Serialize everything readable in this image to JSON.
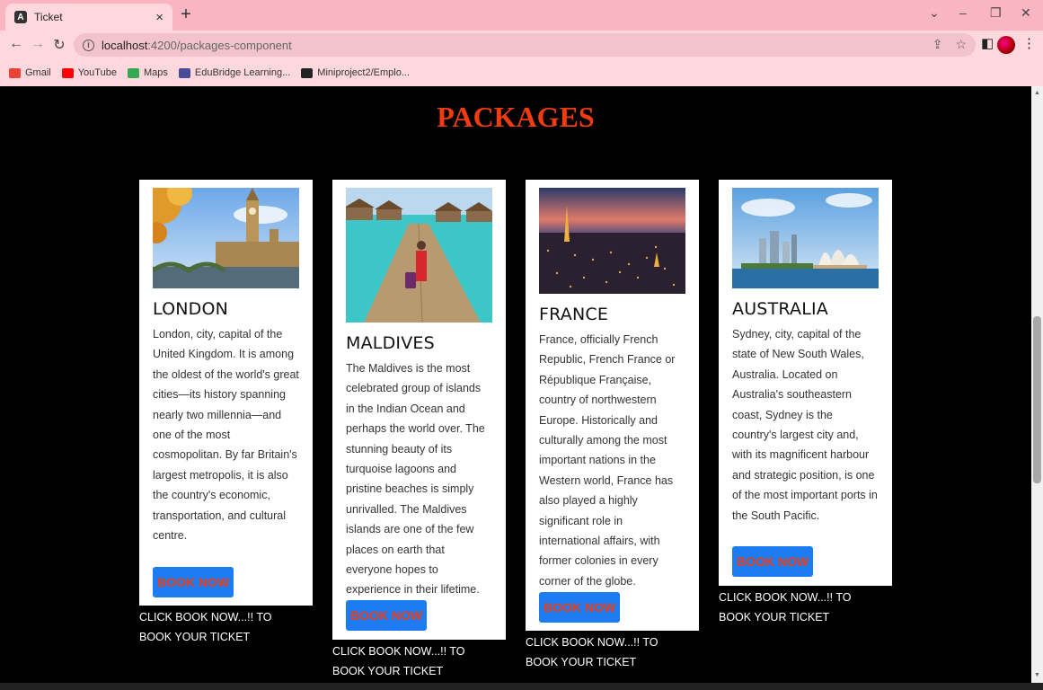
{
  "browser": {
    "tab_title": "Ticket",
    "tab_close": "×",
    "new_tab": "+",
    "url_host": "localhost",
    "url_path": ":4200/packages-component",
    "bookmarks": [
      {
        "label": "Gmail",
        "icon": "gmail-icon",
        "color": "#ea4335"
      },
      {
        "label": "YouTube",
        "icon": "youtube-icon",
        "color": "#ff0000"
      },
      {
        "label": "Maps",
        "icon": "maps-icon",
        "color": "#34a853"
      },
      {
        "label": "EduBridge Learning...",
        "icon": "edubridge-icon",
        "color": "#4a4a9a"
      },
      {
        "label": "Miniproject2/Emplo...",
        "icon": "github-icon",
        "color": "#222222"
      }
    ]
  },
  "page": {
    "title": "PACKAGES",
    "title_color": "#f13b10",
    "button_color": "#1d7cf2"
  },
  "cards": [
    {
      "title": "LONDON",
      "text": "London, city, capital of the United Kingdom. It is among the oldest of the world's great cities—its history spanning nearly two millennia—and one of the most cosmopolitan. By far Britain's largest metropolis, it is also the country's economic, transportation, and cultural centre.",
      "button": "BOOK NOW",
      "caption": "CLICK BOOK NOW...!! TO BOOK YOUR TICKET",
      "image": "london-big-ben-image"
    },
    {
      "title": "MALDIVES",
      "text": "The Maldives is the most celebrated group of islands in the Indian Ocean and perhaps the world over. The stunning beauty of its turquoise lagoons and pristine beaches is simply unrivalled. The Maldives islands are one of the few places on earth that everyone hopes to experience in their lifetime.",
      "button": "BOOK NOW",
      "caption": "CLICK BOOK NOW...!! TO BOOK YOUR TICKET",
      "image": "maldives-boardwalk-image"
    },
    {
      "title": "FRANCE",
      "text": "France, officially French Republic, French France or République Française, country of northwestern Europe. Historically and culturally among the most important nations in the Western world, France has also played a highly significant role in international affairs, with former colonies in every corner of the globe.",
      "button": "BOOK NOW",
      "caption": "CLICK BOOK NOW...!! TO BOOK YOUR TICKET",
      "image": "paris-night-image"
    },
    {
      "title": "AUSTRALIA",
      "text": "Sydney, city, capital of the state of New South Wales, Australia. Located on Australia's southeastern coast, Sydney is the country's largest city and, with its magnificent harbour and strategic position, is one of the most important ports in the South Pacific.",
      "button": "BOOK NOW",
      "caption": "CLICK BOOK NOW...!! TO BOOK YOUR TICKET",
      "image": "sydney-opera-house-image"
    }
  ]
}
